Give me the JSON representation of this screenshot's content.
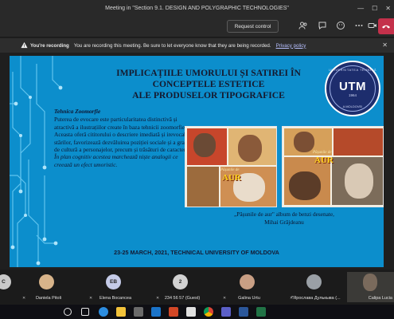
{
  "window": {
    "title": "Meeting in \"Section 9.1. DESIGN AND POLYGRAPHIC TECHNOLOGIES\"",
    "minimize": "—",
    "maximize": "☐",
    "close": "✕"
  },
  "toolbar": {
    "request_control": "Request control",
    "icons": [
      "people-icon",
      "chat-icon",
      "reactions-icon",
      "more-icon",
      "camera-icon"
    ],
    "leave_icon": "phone-hangup-icon"
  },
  "recording": {
    "title": "You're recording",
    "message": "You are recording this meeting. Be sure to let everyone know that they are being recorded.",
    "link": "Privacy policy"
  },
  "slide": {
    "title_line1": "IMPLICAȚIILE UMORULUI ȘI SATIREI  ÎN",
    "title_line2": "CONCEPTELE  ESTETICE",
    "title_line3": "ALE PRODUSELOR TIPOGRAFICE",
    "logo_text": "UTM",
    "logo_ring_top": "UNIVERSITATEA TEHNICĂ",
    "logo_year": "1964",
    "logo_ring_bottom": "A MOLDOVEI",
    "subtitle": "Tehnica Zoomorfie",
    "body": "Puterea de evocare este particularitatea distinctivă și atractivă a ilustrațiilor create în baza tehnicii zoomorfie. Aceasta oferă cititorului o descriere imediată și irevocabilă a stărilor, favorizează dezvăluirea poziției sociale și a gradului de cultură a personajelor, precum și trăsături de caracter.",
    "body_italic": "În plan cognitiv acestea marchează niște analogii ce creează un efect umoristic.",
    "comic_title": "AUR",
    "comic_small": "Pășunile de",
    "caption_line1": "„Pășunile de aur\" album de benzi desenate,",
    "caption_line2": "Mihai Grăjdeanu",
    "footer": "23-25 MARCH, 2021, TECHNICAL UNIVERSITY OF MOLDOVA",
    "background_color": "#0c8ecc"
  },
  "participants": [
    {
      "name": "Daniela Pitoli",
      "initials": "",
      "avatar_color": "#d8b48a"
    },
    {
      "name": "Elena Bocancea",
      "initials": "EB",
      "avatar_color": "#c5cbe8"
    },
    {
      "name": "234 56 57 (Guest)",
      "initials": "2",
      "avatar_color": "#d2d2d2"
    },
    {
      "name": "Galina Urtu",
      "initials": "",
      "avatar_color": "#c99f84"
    },
    {
      "name": "\"Ярослава Дулькыва (...",
      "initials": "",
      "avatar_color": "#9aa0a6"
    },
    {
      "name": "Calipa Lucia",
      "initials": "",
      "avatar_color": "#7a6a5c"
    }
  ],
  "partial_tile_initials": "C",
  "taskbar": {
    "icons": [
      "search-icon",
      "task-view-icon",
      "edge-icon",
      "file-explorer-icon",
      "store-icon",
      "mail-icon",
      "powerpoint-icon",
      "chrome-icon",
      "teams-icon",
      "word-icon",
      "excel-icon"
    ]
  }
}
